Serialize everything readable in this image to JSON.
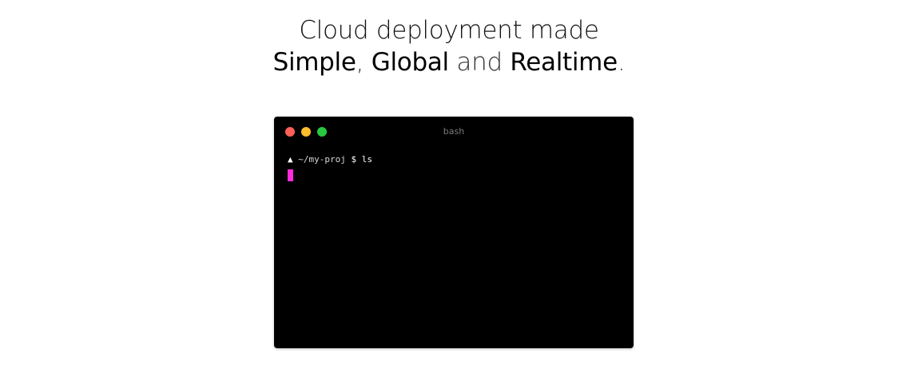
{
  "page": {
    "corner_mark": "ʼ"
  },
  "hero": {
    "line1": "Cloud deployment made",
    "word_simple": "Simple",
    "comma": ",",
    "word_global": "Global",
    "word_and": "and",
    "word_realtime": "Realtime",
    "period": "."
  },
  "terminal": {
    "title": "bash",
    "prompt_symbol": "▲",
    "path": "~/my-proj",
    "dollar": "$",
    "command": "ls",
    "dot_colors": {
      "close": "#ff5f57",
      "minimize": "#ffbd2e",
      "maximize": "#28c940"
    },
    "cursor_color": "#ff2bdc"
  }
}
